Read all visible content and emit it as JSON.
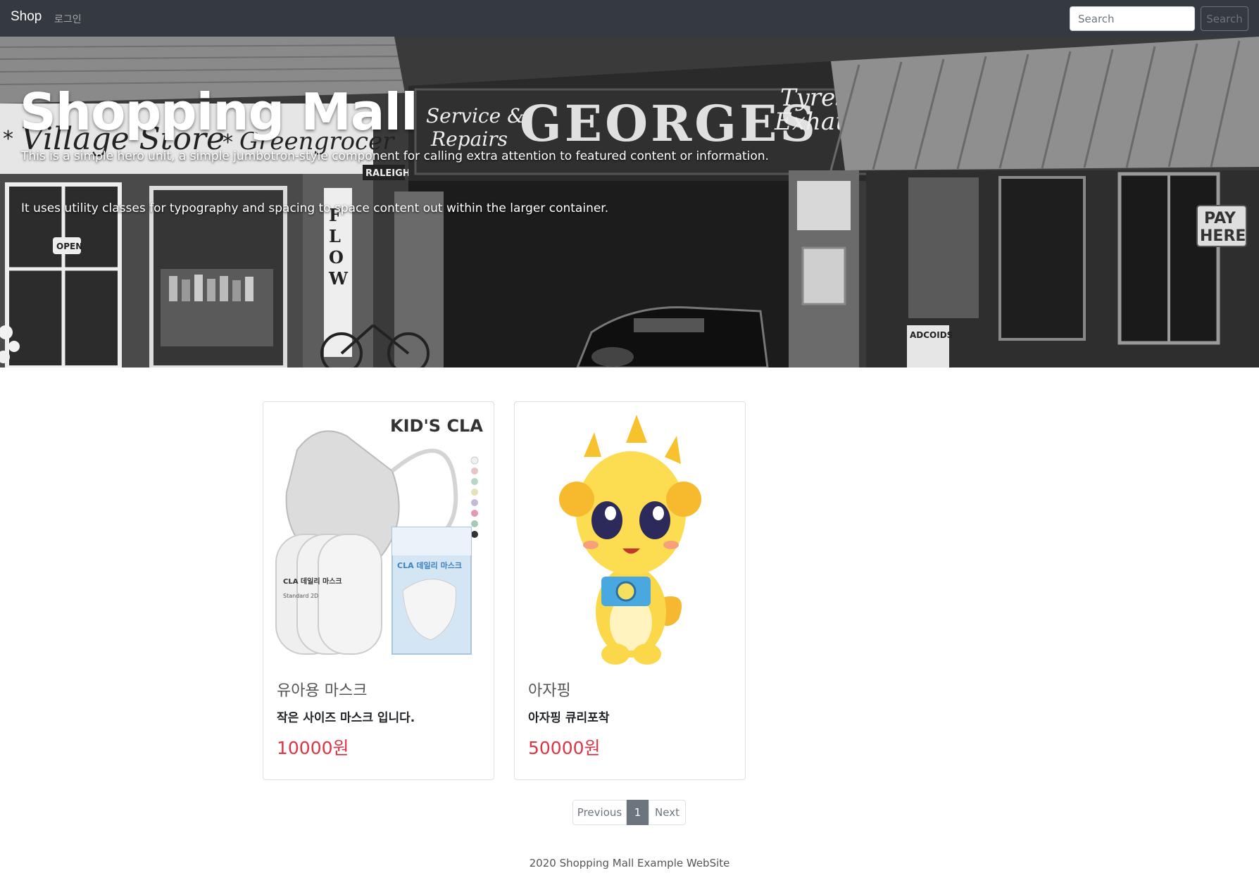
{
  "navbar": {
    "brand": "Shop",
    "login_link": "로그인",
    "search_placeholder": "Search",
    "search_button": "Search"
  },
  "hero": {
    "title": "Shopping Mall",
    "lead": "This is a simple hero unit, a simple jumbotron-style component for calling extra attention to featured content or information.",
    "text": "It uses utility classes for typography and spacing to space content out within the larger container.",
    "signs": {
      "village_store": "Village Store",
      "greengrocer": "Greengrocer",
      "service": "Service &",
      "repairs": "Repairs",
      "georges": "GEORGES",
      "tyres": "Tyres &",
      "exhausts": "Exhausts",
      "open": "OPEN",
      "raleigh": "RALEIGH",
      "pay": "PAY",
      "here": "HERE",
      "adcoids": "ADCOIDS"
    }
  },
  "products": [
    {
      "name": "유아용 마스크",
      "description": "작은 사이즈 마스크 입니다.",
      "price": "10000원",
      "image_icon": "mask-product-image",
      "image_texts": {
        "brand": "KID'S CLA",
        "box_label": "CLA 데일리 마스크",
        "pack_label": "CLA 데일리 마스크",
        "pack_sub": "Standard 2D"
      }
    },
    {
      "name": "아자핑",
      "description": "아자핑 큐리포착",
      "price": "50000원",
      "image_icon": "character-toy-image"
    }
  ],
  "pagination": {
    "previous": "Previous",
    "current": "1",
    "next": "Next"
  },
  "footer": {
    "text": "2020 Shopping Mall Example WebSite"
  },
  "colors": {
    "navbar_bg": "#343a40",
    "price": "#dc3545",
    "pagination_active": "#6c757d"
  }
}
